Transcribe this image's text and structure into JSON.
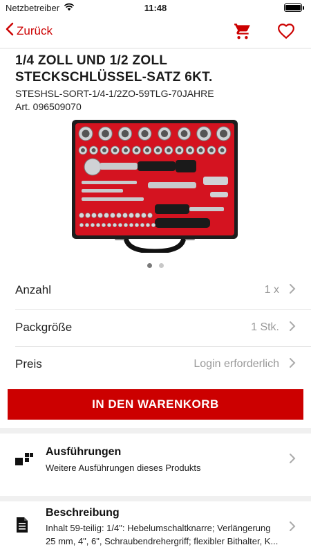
{
  "status_bar": {
    "carrier": "Netzbetreiber",
    "time": "11:48",
    "wifi_icon": "wifi-icon",
    "battery_level": 1.0
  },
  "nav": {
    "back_label": "Zurück",
    "cart_icon": "shopping-cart-icon",
    "favorite_icon": "heart-icon"
  },
  "product": {
    "title": "1/4 ZOLL UND 1/2 ZOLL STECKSCHLÜSSEL-SATZ 6KT.",
    "sku": "STESHSL-SORT-1/4-1/2ZO-59TLG-70JAHRE",
    "article": "Art. 096509070",
    "image_icon": "socket-wrench-set-image",
    "image_count": 2,
    "image_index": 1
  },
  "details": [
    {
      "label": "Anzahl",
      "value": "1 x"
    },
    {
      "label": "Packgröße",
      "value": "1 Stk."
    },
    {
      "label": "Preis",
      "value": "Login erforderlich"
    }
  ],
  "add_to_cart_label": "IN DEN WARENKORB",
  "sections": {
    "variants": {
      "title": "Ausführungen",
      "subtitle": "Weitere Ausführungen dieses Produkts",
      "icon": "variants-icon"
    },
    "description": {
      "title": "Beschreibung",
      "subtitle": "Inhalt 59-teilig: 1/4\": Hebelumschaltknarre; Verlängerung 25 mm, 4\", 6\", Schraubendrehergriff; flexibler Bithalter, K...",
      "icon": "document-icon"
    }
  },
  "colors": {
    "accent": "#cc0000",
    "muted": "#999999"
  }
}
